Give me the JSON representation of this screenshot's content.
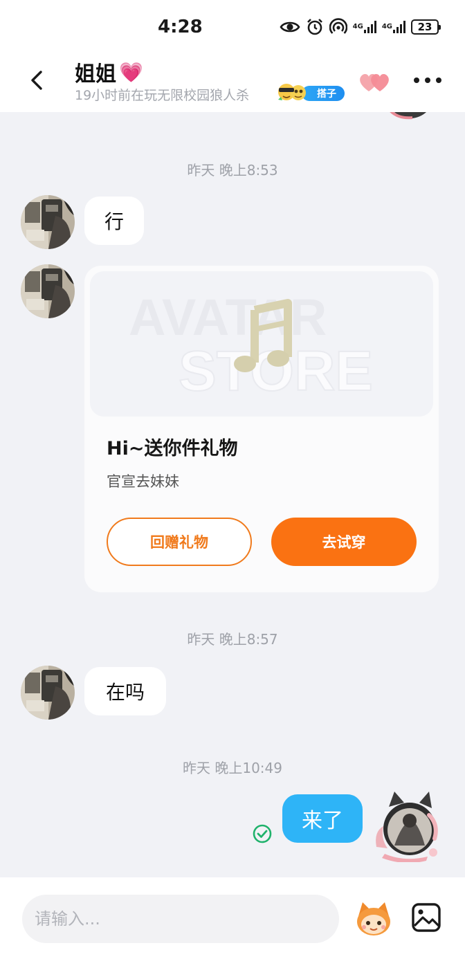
{
  "status_bar": {
    "time": "4:28",
    "network_1": "4G",
    "network_2": "4G",
    "battery": "23",
    "icons": [
      "eye-icon",
      "alarm-icon",
      "hotspot-icon",
      "signal-icon",
      "signal-icon",
      "battery-icon"
    ]
  },
  "header": {
    "contact_name": "姐姐",
    "name_emoji": "💗",
    "status": "19小时前在玩无限校园狼人杀",
    "partner_tag": "搭子",
    "icons": [
      "back-arrow-icon",
      "hearts-icon",
      "more-icon"
    ]
  },
  "messages": [
    {
      "timestamp": "昨天 晚上8:53",
      "from": "contact",
      "text": "行"
    },
    {
      "from": "contact",
      "type": "gift_card",
      "image_watermark_1": "AVATAR",
      "image_watermark_2": "STORE",
      "title": "Hi~送你件礼物",
      "subtitle": "官宣去妹妹",
      "button_secondary": "回赠礼物",
      "button_primary": "去试穿"
    },
    {
      "timestamp": "昨天 晚上8:57",
      "from": "contact",
      "text": "在吗"
    },
    {
      "timestamp": "昨天 晚上10:49",
      "from": "me",
      "text": "来了",
      "status": "read"
    }
  ],
  "input": {
    "placeholder": "请输入...",
    "icons": [
      "emoji-mascot-icon",
      "image-icon"
    ]
  },
  "colors": {
    "background": "#f1f2f6",
    "outgoing_bubble": "#2eb4f7",
    "accent_orange": "#fa7212",
    "partner_badge": "#1e8ef0",
    "read_check": "#1fb26b"
  }
}
